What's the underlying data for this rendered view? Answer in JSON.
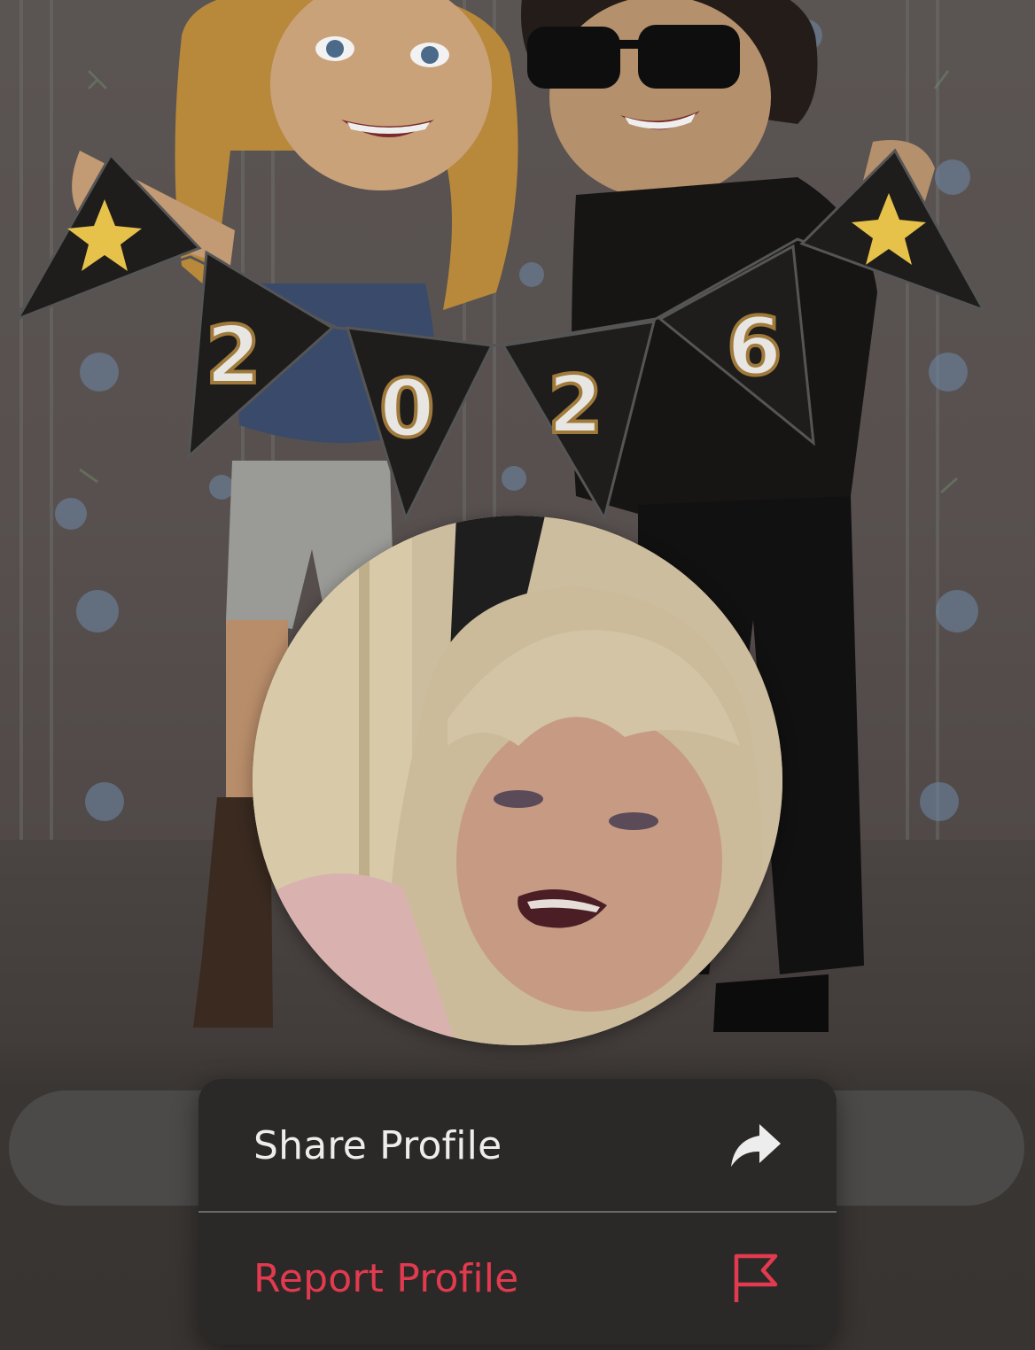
{
  "banner": {
    "bitmoji_scene": "two avatars holding 2026 pennant banner",
    "banner_text": [
      "2",
      "0",
      "2",
      "6"
    ]
  },
  "profile": {
    "photo_description": "profile-photo"
  },
  "menu": {
    "items": [
      {
        "label": "Share Profile",
        "icon": "share-arrow-icon",
        "color": "#ededed"
      },
      {
        "label": "Report Profile",
        "icon": "flag-icon",
        "color": "#e23a4e"
      }
    ]
  },
  "colors": {
    "menu_background": "#2a2928",
    "report_red": "#e23a4e",
    "pill_background": "#4c4a49"
  }
}
